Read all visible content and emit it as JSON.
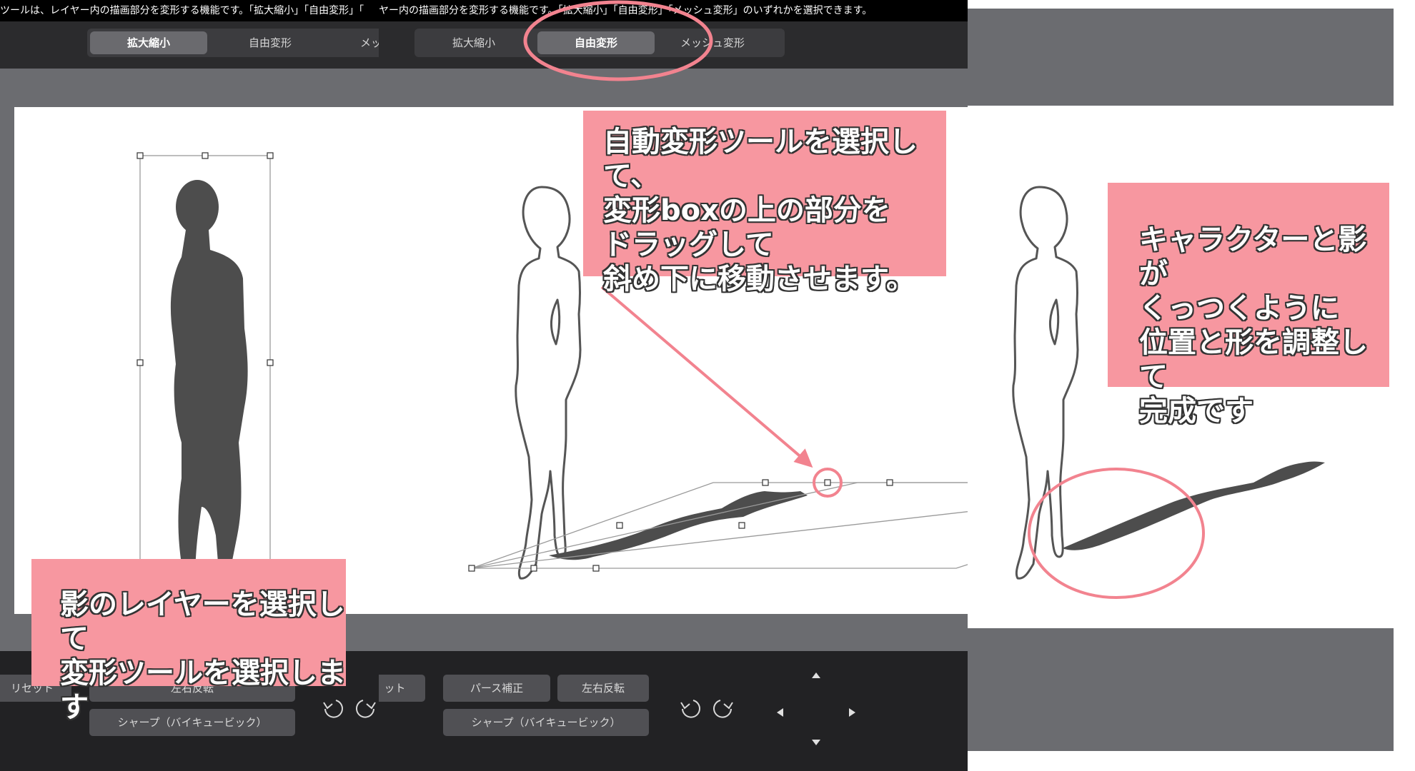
{
  "panels": [
    {
      "id": "panel-1",
      "topbar_text": "ツールは、レイヤー内の描画部分を変形する機能です。「拡大縮小」「自由変形」「",
      "tabs": [
        "拡大縮小",
        "自由変形",
        "メッ"
      ],
      "active_tab": 0,
      "buttons": {
        "reset": "リセット",
        "flip": "左右反転",
        "sharp": "シャープ（バイキュービック）"
      },
      "callout": "影のレイヤーを選択して\n変形ツールを選択します"
    },
    {
      "id": "panel-2",
      "topbar_text": "ヤー内の描画部分を変形する機能です。「拡大縮小」「自由変形」「メッシュ変形」のいずれかを選択できます。",
      "tabs": [
        "拡大縮小",
        "自由変形",
        "メッシュ変形"
      ],
      "active_tab": 1,
      "buttons": {
        "reset": "ット",
        "perspective": "パース補正",
        "flip": "左右反転",
        "sharp": "シャープ（バイキュービック）"
      },
      "callout": "自動変形ツールを選択して、\n変形boxの上の部分を\nドラッグして\n斜め下に移動させます。"
    },
    {
      "id": "panel-3",
      "callout": "キャラクターと影が\nくっつくように\n位置と形を調整して\n完成です"
    }
  ],
  "icons": {
    "undo": "undo-icon",
    "redo": "redo-icon",
    "arrows": [
      "arrow-up-icon",
      "arrow-left-icon",
      "arrow-right-icon",
      "arrow-down-icon"
    ]
  },
  "colors": {
    "callout": "#f797a0",
    "highlight": "#f2838f",
    "dark_bg": "#222224",
    "active_tab": "#6a6a6e"
  }
}
